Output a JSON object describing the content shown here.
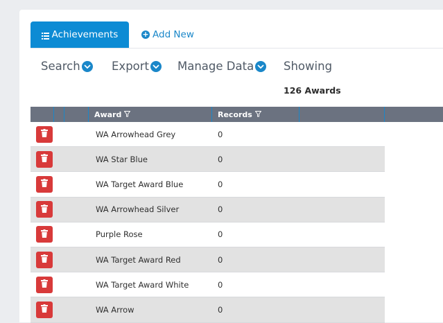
{
  "tabs": {
    "active_label": "Achievements",
    "add_label": "Add New"
  },
  "toolbar": {
    "search": "Search",
    "export": "Export",
    "manage": "Manage Data",
    "showing": "Showing"
  },
  "count_text": "126 Awards",
  "table": {
    "headers": {
      "award": "Award",
      "records": "Records"
    },
    "rows": [
      {
        "award": "WA Arrowhead Grey",
        "records": "0"
      },
      {
        "award": "WA Star Blue",
        "records": "0"
      },
      {
        "award": "WA Target Award Blue",
        "records": "0"
      },
      {
        "award": "WA Arrowhead Silver",
        "records": "0"
      },
      {
        "award": "Purple Rose",
        "records": "0"
      },
      {
        "award": "WA Target Award Red",
        "records": "0"
      },
      {
        "award": "WA Target Award White",
        "records": "0"
      },
      {
        "award": "WA Arrow",
        "records": "0"
      }
    ]
  },
  "icons": {
    "tab": "list-icon",
    "add": "plus-circle-icon",
    "dropdown": "chevron-down-icon",
    "filter": "filter-icon",
    "delete": "trash-icon"
  },
  "colors": {
    "accent": "#0d8bd4",
    "delete": "#d83a3a",
    "header": "#6b7280"
  }
}
